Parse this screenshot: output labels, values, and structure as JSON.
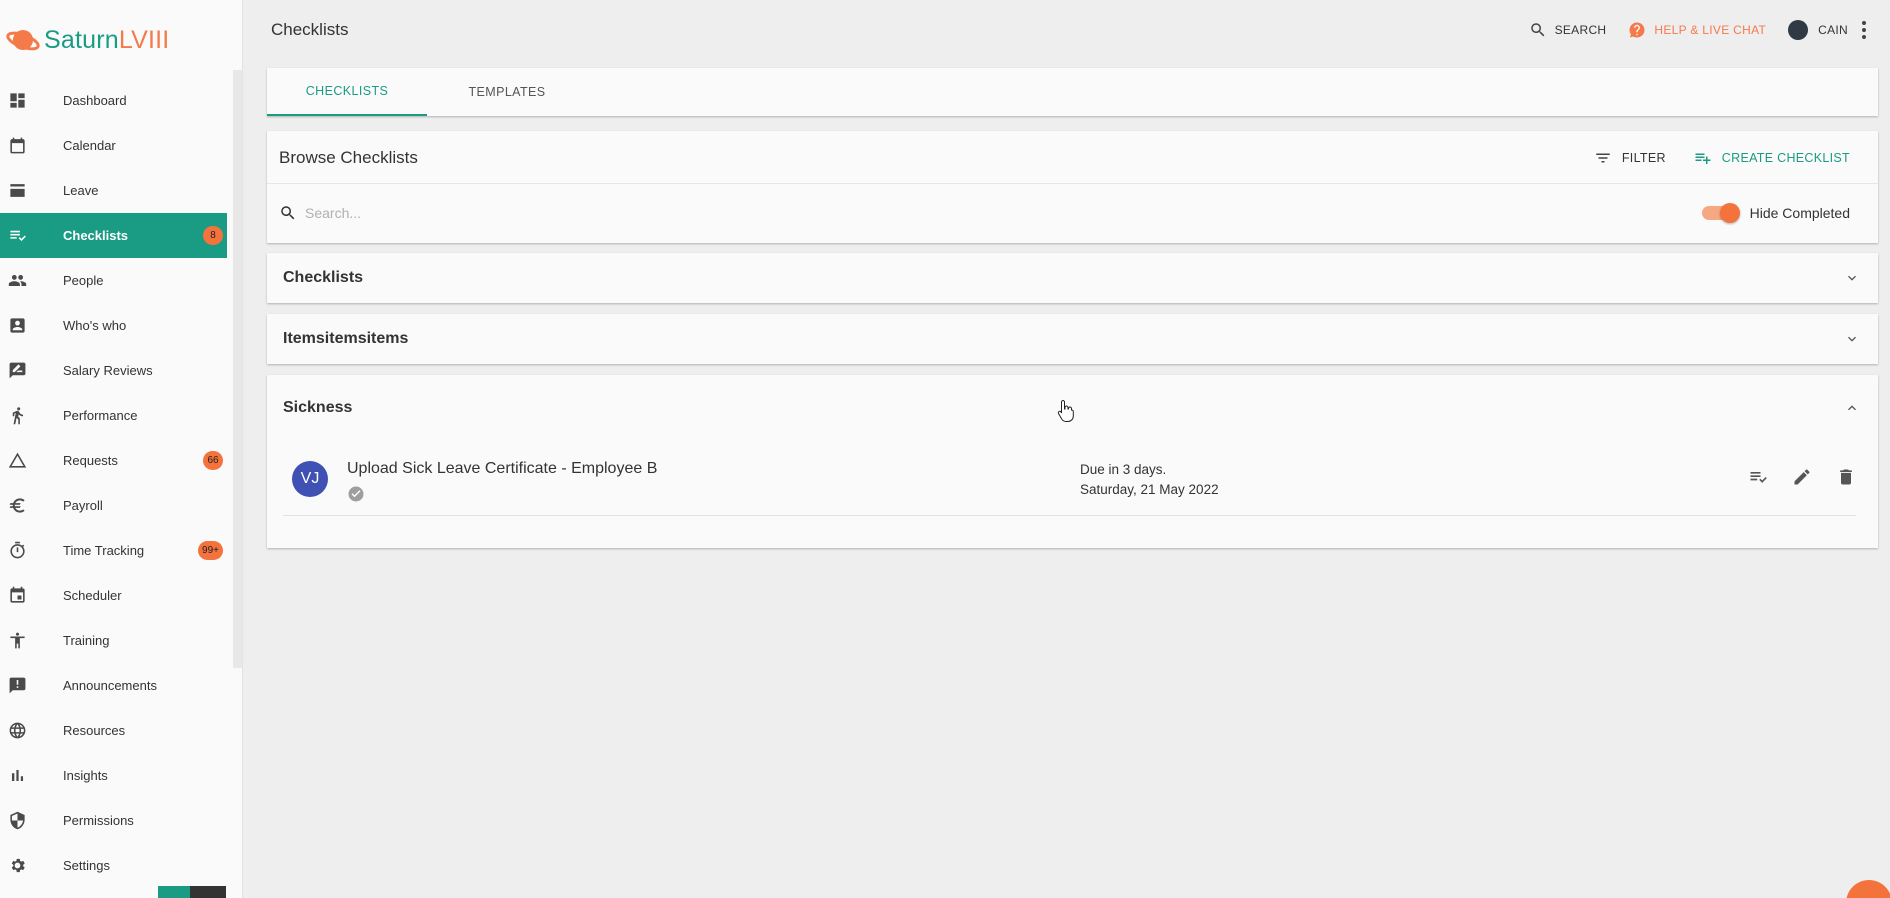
{
  "app": {
    "logo_primary": "Saturn",
    "logo_accent": "LVIII",
    "brand_color": "#1a9b84",
    "accent_color": "#f4733d"
  },
  "sidebar": {
    "items": [
      {
        "label": "Dashboard",
        "icon": "dashboard-icon"
      },
      {
        "label": "Calendar",
        "icon": "calendar-icon"
      },
      {
        "label": "Leave",
        "icon": "leave-icon"
      },
      {
        "label": "Checklists",
        "icon": "checklist-icon",
        "badge": "8",
        "active": true
      },
      {
        "label": "People",
        "icon": "people-icon"
      },
      {
        "label": "Who's who",
        "icon": "badge-icon"
      },
      {
        "label": "Salary Reviews",
        "icon": "salary-icon"
      },
      {
        "label": "Performance",
        "icon": "running-icon"
      },
      {
        "label": "Requests",
        "icon": "triangle-icon",
        "badge": "66"
      },
      {
        "label": "Payroll",
        "icon": "euro-icon"
      },
      {
        "label": "Time Tracking",
        "icon": "stopwatch-icon",
        "badge": "99+"
      },
      {
        "label": "Scheduler",
        "icon": "event-icon"
      },
      {
        "label": "Training",
        "icon": "accessibility-icon"
      },
      {
        "label": "Announcements",
        "icon": "announcement-icon"
      },
      {
        "label": "Resources",
        "icon": "globe-icon"
      },
      {
        "label": "Insights",
        "icon": "bar-chart-icon"
      },
      {
        "label": "Permissions",
        "icon": "shield-icon"
      },
      {
        "label": "Settings",
        "icon": "settings-icon"
      }
    ]
  },
  "header": {
    "title": "Checklists",
    "search_label": "SEARCH",
    "help_label": "HELP & LIVE CHAT",
    "user_label": "CAIN"
  },
  "tabs": [
    {
      "label": "CHECKLISTS",
      "active": true
    },
    {
      "label": "TEMPLATES",
      "active": false
    }
  ],
  "browse": {
    "title": "Browse Checklists",
    "filter_label": "FILTER",
    "create_label": "CREATE CHECKLIST",
    "search_placeholder": "Search...",
    "search_value": "",
    "hide_completed_label": "Hide Completed",
    "hide_completed_on": true
  },
  "groups": [
    {
      "title": "Checklists",
      "expanded": false
    },
    {
      "title": "Itemsitemsitems",
      "expanded": false
    },
    {
      "title": "Sickness",
      "expanded": true,
      "items": [
        {
          "initials": "VJ",
          "title": "Upload Sick Leave Certificate - Employee B",
          "due_line1": "Due in 3 days.",
          "due_line2": "Saturday, 21 May 2022"
        }
      ]
    }
  ]
}
